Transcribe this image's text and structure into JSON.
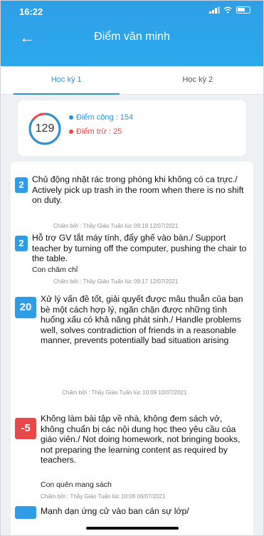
{
  "status": {
    "time": "16:22"
  },
  "header": {
    "title": "Điểm văn minh"
  },
  "tabs": [
    {
      "label": "Học kỳ 1",
      "active": true
    },
    {
      "label": "Học kỳ 2",
      "active": false
    }
  ],
  "summary": {
    "total": "129",
    "plus_label": "Điểm cộng : 154",
    "minus_label": "Điểm trừ : 25",
    "plus_color": "#2b92d6",
    "minus_color": "#e8474b"
  },
  "entries": [
    {
      "points": "2",
      "type": "positive",
      "description": "Chủ động nhặt rác trong phòng khi không có ca trực./ Actively pick up trash in the room when there is no shift on duty.",
      "note": "",
      "graded": "Chấm bởi : Thầy Giáo Tuấn lúc 09:18 12/07/2021"
    },
    {
      "points": "2",
      "type": "positive",
      "description": "Hỗ trợ GV tắt máy tính, đẩy ghế vào bàn./ Support teacher by turning off the computer, pushing the chair to the table.",
      "note": "Con chăm chỉ",
      "graded": "Chấm bởi : Thầy Giáo Tuấn lúc 09:17 12/07/2021"
    },
    {
      "points": "20",
      "type": "positive",
      "description": "Xử lý vấn đề tốt, giải quyết được mâu thuẫn của bạn bè một cách hợp lý, ngăn chặn được những tình huống xấu có khả năng phát sinh./ Handle problems well, solves contradiction of friends in a reasonable manner, prevents potentially bad situation arising",
      "note": "",
      "graded": "Chấm bởi : Thầy Giáo Tuấn lúc 10:09 10/07/2021"
    },
    {
      "points": "-5",
      "type": "negative",
      "description": "Không làm bài tập về nhà, không đem sách vở, không chuẩn bị các nội dung học theo yêu cầu của giáo viên./ Not doing homework, not bringing books, not preparing the learning content as required by teachers.",
      "note": "Con quên mang sách",
      "graded": "Chấm bởi : Thầy Giáo Tuấn lúc 10:08 06/07/2021"
    },
    {
      "points": "",
      "type": "positive",
      "description": "Mạnh dạn ứng cử vào ban cán sự lớp/",
      "note": "",
      "graded": ""
    }
  ]
}
